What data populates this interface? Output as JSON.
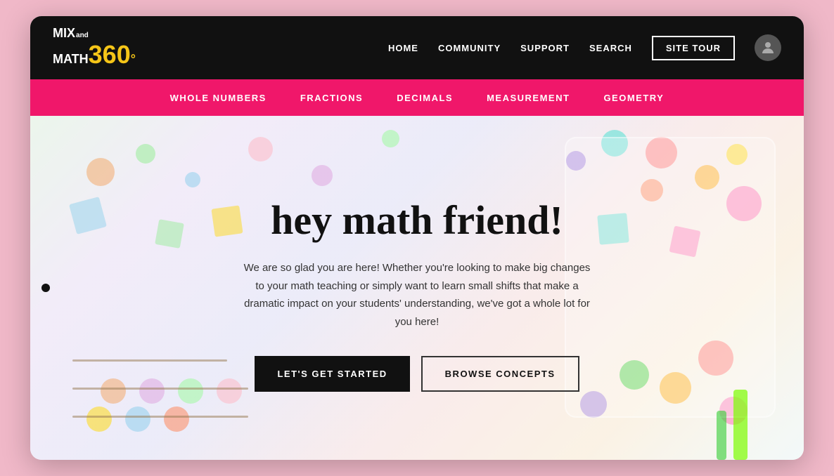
{
  "browser": {
    "background": "#f0b8c8"
  },
  "logo": {
    "mix": "MIX",
    "and": "and",
    "math": "MATH",
    "number": "360",
    "degree": "°"
  },
  "topnav": {
    "home": "HOME",
    "community": "COMMUNITY",
    "support": "SUPPORT",
    "search": "SEARCH",
    "site_tour": "SITE TOUR"
  },
  "categorynav": {
    "items": [
      {
        "label": "WHOLE NUMBERS",
        "id": "whole-numbers"
      },
      {
        "label": "FRACTIONS",
        "id": "fractions"
      },
      {
        "label": "DECIMALS",
        "id": "decimals"
      },
      {
        "label": "MEASUREMENT",
        "id": "measurement"
      },
      {
        "label": "GEOMETRY",
        "id": "geometry"
      }
    ]
  },
  "hero": {
    "title": "hey math friend!",
    "subtitle": "We are so glad you are here! Whether you're looking to make big changes to your math teaching or simply want to learn small shifts that make a dramatic impact on your students' understanding, we've got a whole lot for you here!",
    "btn_started": "LET'S GET STARTED",
    "btn_browse": "BROWSE CONCEPTS"
  }
}
